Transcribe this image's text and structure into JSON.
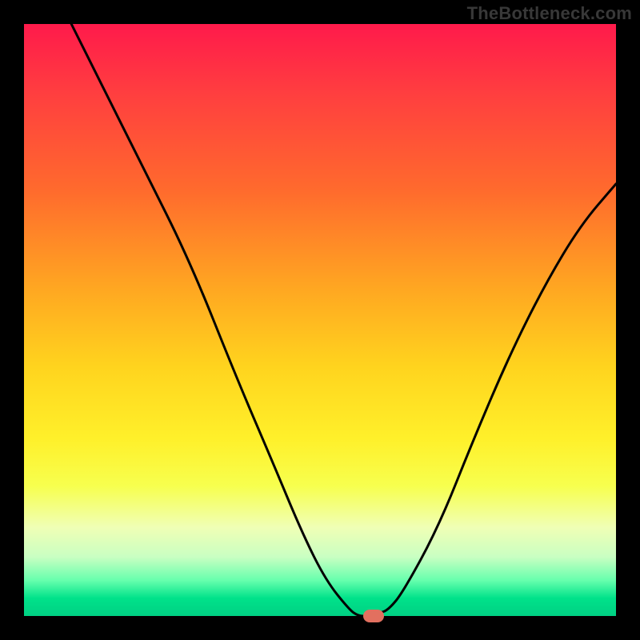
{
  "watermark": "TheBottleneck.com",
  "chart_data": {
    "type": "line",
    "title": "",
    "xlabel": "",
    "ylabel": "",
    "xlim": [
      0,
      100
    ],
    "ylim": [
      0,
      100
    ],
    "grid": false,
    "legend": false,
    "series": [
      {
        "name": "curve",
        "x": [
          8,
          12,
          20,
          28,
          36,
          42,
          47,
          51,
          55,
          56.5,
          58,
          60,
          61.5,
          64,
          70,
          76,
          82,
          88,
          94,
          100
        ],
        "values": [
          100,
          92,
          76,
          60,
          40,
          26,
          14,
          6,
          1,
          0,
          0,
          0.5,
          1,
          4,
          15,
          30,
          44,
          56,
          66,
          73
        ]
      }
    ],
    "marker": {
      "x": 59,
      "y": 0
    },
    "background_gradient": {
      "top": "#ff1a4b",
      "mid": "#ffd41e",
      "bottom": "#00d083"
    },
    "line_color": "#000000",
    "marker_color": "#e2705f"
  }
}
